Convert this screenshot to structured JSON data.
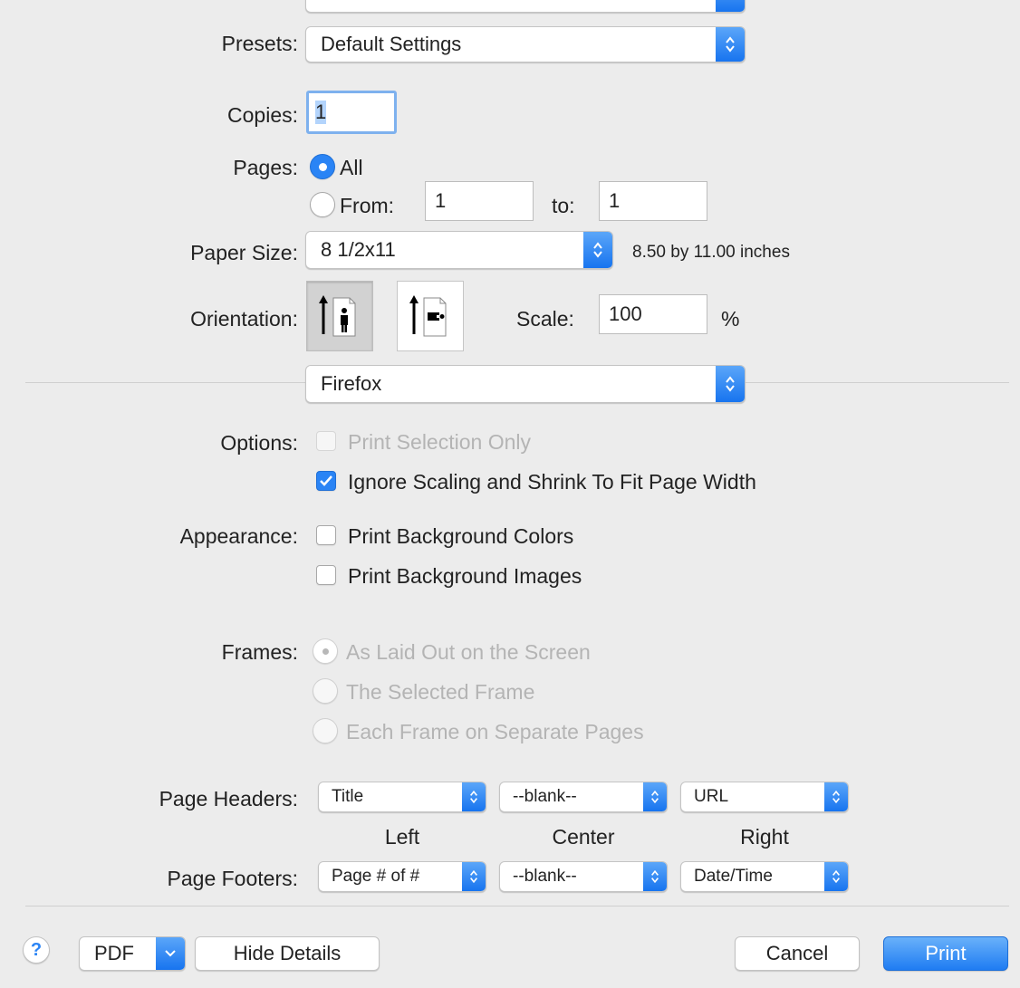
{
  "printer_popup": {
    "value": ""
  },
  "presets": {
    "label": "Presets:",
    "value": "Default Settings"
  },
  "copies": {
    "label": "Copies:",
    "value": "1"
  },
  "pages": {
    "label": "Pages:",
    "all_label": "All",
    "from_label": "From:",
    "from_value": "1",
    "to_label": "to:",
    "to_value": "1",
    "selected": "All"
  },
  "paper_size": {
    "label": "Paper Size:",
    "value": "8 1/2x11",
    "dimensions": "8.50 by 11.00 inches"
  },
  "orientation": {
    "label": "Orientation:",
    "selected": "portrait"
  },
  "scale": {
    "label": "Scale:",
    "value": "100",
    "unit": "%"
  },
  "section_popup": {
    "value": "Firefox"
  },
  "options": {
    "label": "Options:",
    "print_selection_only": {
      "label": "Print Selection Only",
      "checked": false,
      "enabled": false
    },
    "ignore_scaling": {
      "label": "Ignore Scaling and Shrink To Fit Page Width",
      "checked": true,
      "enabled": true
    }
  },
  "appearance": {
    "label": "Appearance:",
    "bg_colors": {
      "label": "Print Background Colors",
      "checked": false
    },
    "bg_images": {
      "label": "Print Background Images",
      "checked": false
    }
  },
  "frames": {
    "label": "Frames:",
    "items": [
      "As Laid Out on the Screen",
      "The Selected Frame",
      "Each Frame on Separate Pages"
    ],
    "selected": "As Laid Out on the Screen",
    "enabled": false
  },
  "headers": {
    "label": "Page Headers:",
    "left": "Title",
    "center": "--blank--",
    "right": "URL"
  },
  "column_labels": {
    "left": "Left",
    "center": "Center",
    "right": "Right"
  },
  "footers": {
    "label": "Page Footers:",
    "left": "Page # of #",
    "center": "--blank--",
    "right": "Date/Time"
  },
  "footer_bar": {
    "help": "?",
    "pdf": "PDF",
    "hide_details": "Hide Details",
    "cancel": "Cancel",
    "print": "Print"
  },
  "colors": {
    "accent": "#2a84f5",
    "background": "#ececec",
    "disabled_text": "#b4b4b4"
  }
}
